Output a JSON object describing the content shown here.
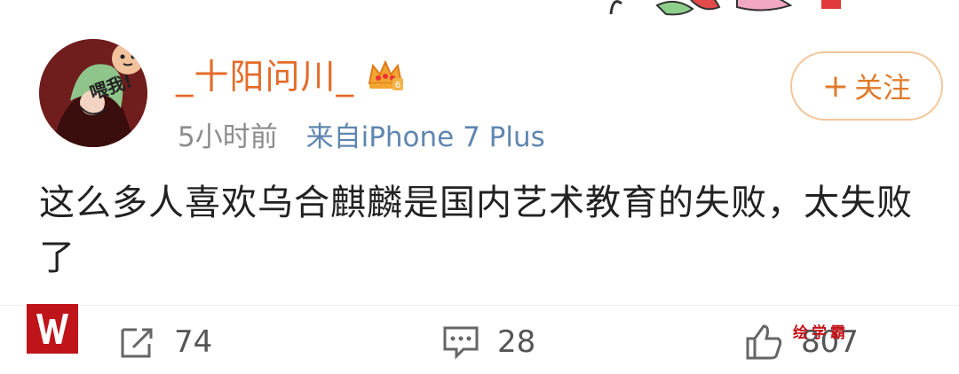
{
  "post": {
    "username": "_十阳问川_",
    "vip_level": "6",
    "time": "5小时前",
    "source": "来自iPhone 7 Plus",
    "text": "这么多人喜欢乌合麒麟是国内艺术教育的失败，太失败了",
    "follow_label": "关注",
    "follow_symbol": "+",
    "avatar_text": "喂我!"
  },
  "actions": {
    "repost_count": "74",
    "comment_count": "28",
    "like_count": "807"
  },
  "watermark": {
    "text": "绘学霸"
  },
  "colors": {
    "username": "#e46b2a",
    "source": "#5f86b0",
    "follow_border": "#f4c59a",
    "watermark_red": "#c0141b"
  },
  "icons": [
    "repost-icon",
    "comment-icon",
    "like-icon",
    "vip-crown-icon"
  ]
}
